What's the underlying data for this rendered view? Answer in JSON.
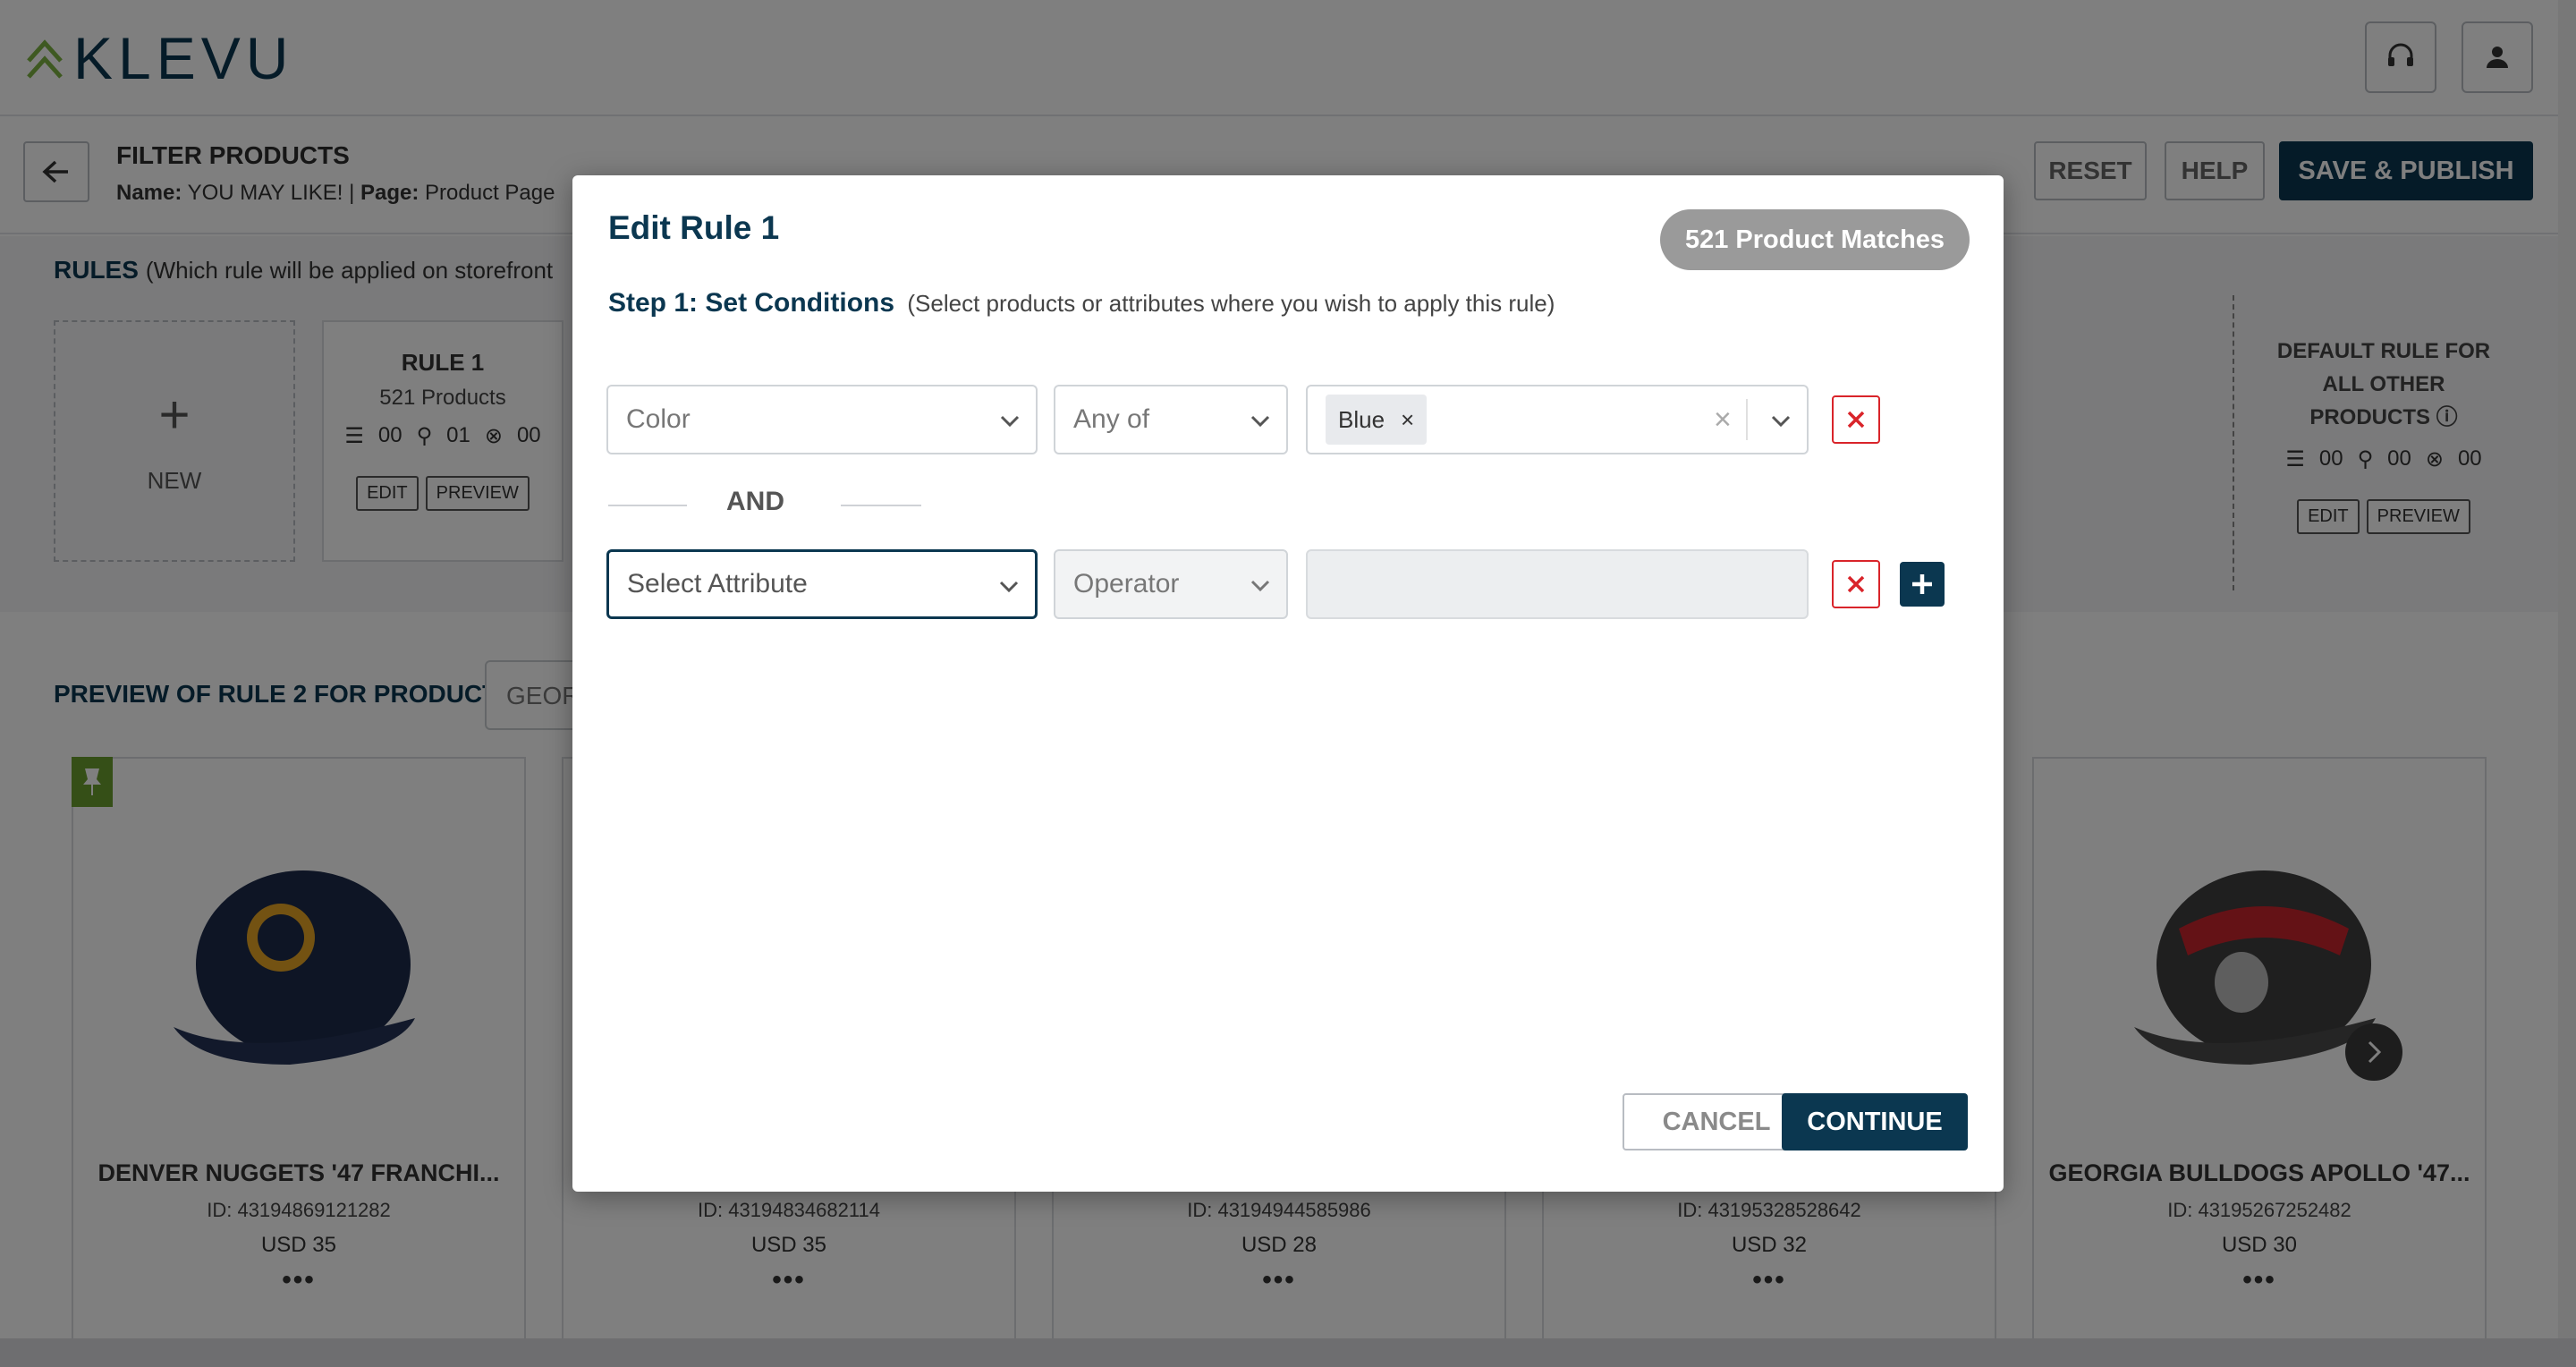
{
  "app": {
    "logo_text": "KLEVU"
  },
  "header": {
    "title": "FILTER PRODUCTS",
    "name_label": "Name:",
    "name_value": "YOU MAY LIKE!",
    "separator": "|",
    "page_label": "Page:",
    "page_value": "Product Page",
    "reset_label": "RESET",
    "help_label": "HELP",
    "publish_label": "SAVE & PUBLISH"
  },
  "rules": {
    "title": "RULES",
    "subtitle": "(Which rule will be applied on storefront",
    "new_label": "NEW",
    "rule1": {
      "title": "RULE 1",
      "products": "521 Products",
      "stat_a": "00",
      "stat_b": "01",
      "stat_c": "00",
      "edit": "EDIT",
      "preview": "PREVIEW"
    },
    "default": {
      "title_line1": "DEFAULT RULE FOR",
      "title_line2": "ALL OTHER",
      "title_line3": "PRODUCTS",
      "stat_a": "00",
      "stat_b": "00",
      "stat_c": "00",
      "edit": "EDIT",
      "preview": "PREVIEW"
    }
  },
  "preview": {
    "title": "PREVIEW OF RULE 2 FOR PRODUCT",
    "select_value": "GEOR",
    "products": [
      {
        "name": "DENVER NUGGETS '47 FRANCHI...",
        "id": "ID: 43194869121282",
        "price": "USD 35",
        "dots": "•••"
      },
      {
        "name": "",
        "id": "ID: 43194834682114",
        "price": "USD 35",
        "dots": "•••"
      },
      {
        "name": "",
        "id": "ID: 43194944585986",
        "price": "USD 28",
        "dots": "•••"
      },
      {
        "name": "",
        "id": "ID: 43195328528642",
        "price": "USD 32",
        "dots": "•••"
      },
      {
        "name": "GEORGIA BULLDOGS APOLLO '47...",
        "id": "ID: 43195267252482",
        "price": "USD 30",
        "dots": "•••"
      }
    ]
  },
  "modal": {
    "title": "Edit Rule 1",
    "matches": "521 Product Matches",
    "step_label": "Step 1:",
    "step_title": "Set Conditions",
    "step_hint": "(Select products or attributes where you wish to apply this rule)",
    "row1": {
      "attribute": "Color",
      "operator": "Any of",
      "tag": "Blue",
      "tag_remove": "×",
      "clear": "×"
    },
    "and_label": "AND",
    "row2": {
      "attribute_placeholder": "Select Attribute",
      "operator_placeholder": "Operator"
    },
    "cancel_label": "CANCEL",
    "continue_label": "CONTINUE"
  },
  "colors": {
    "brand_navy": "#0b3750",
    "danger": "#d9242a",
    "pin_green": "#6a9f2e",
    "logo_green": "#7cb342"
  }
}
